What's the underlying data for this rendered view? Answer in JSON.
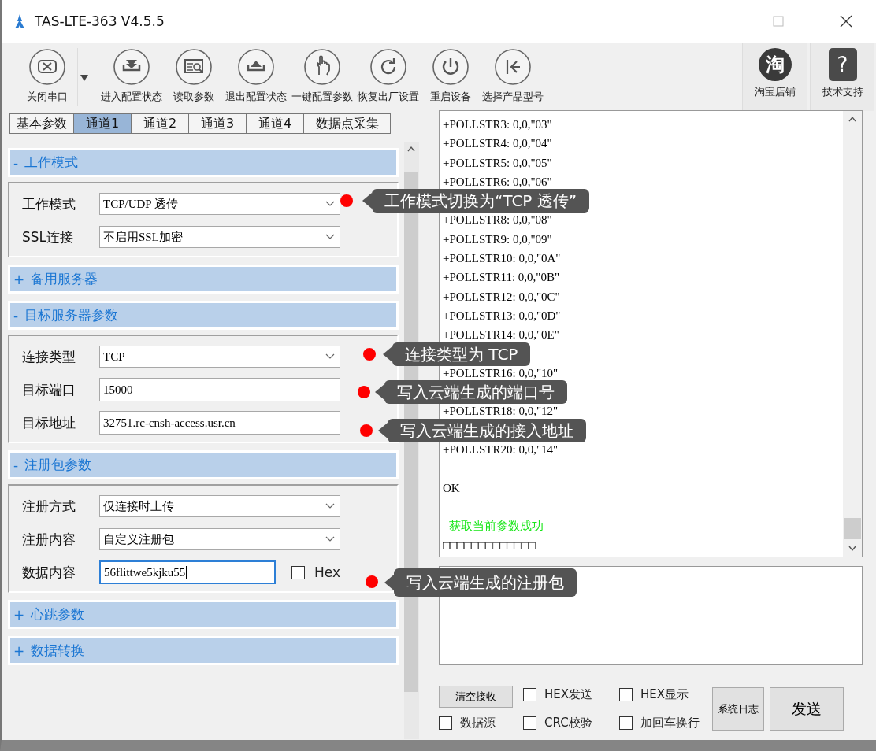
{
  "window": {
    "title": "TAS-LTE-363 V4.5.5"
  },
  "toolbar": [
    {
      "label": "关闭串口",
      "kind": "close",
      "has_menu": true
    },
    {
      "label": "进入配置状态",
      "kind": "enter",
      "has_menu": false
    },
    {
      "label": "读取参数",
      "kind": "read",
      "has_menu": false
    },
    {
      "label": "退出配置状态",
      "kind": "exit",
      "has_menu": false
    },
    {
      "label": "一键配置参数",
      "kind": "hand",
      "has_menu": false
    },
    {
      "label": "恢复出厂设置",
      "kind": "restore",
      "has_menu": false
    },
    {
      "label": "重启设备",
      "kind": "power",
      "has_menu": false
    },
    {
      "label": "选择产品型号",
      "kind": "back",
      "has_menu": false
    }
  ],
  "links": [
    {
      "label": "淘宝店铺",
      "kind": "shop",
      "icon_text": "淘"
    },
    {
      "label": "技术支持",
      "kind": "help",
      "icon_text": "?"
    }
  ],
  "tabs": [
    {
      "label": "基本参数",
      "selected": false
    },
    {
      "label": "通道1",
      "selected": true
    },
    {
      "label": "通道2",
      "selected": false
    },
    {
      "label": "通道3",
      "selected": false
    },
    {
      "label": "通道4",
      "selected": false
    },
    {
      "label": "数据点采集",
      "selected": false
    }
  ],
  "sections": [
    {
      "toggle": "-",
      "title": "工作模式",
      "expanded": true,
      "fields": [
        {
          "kind": "select",
          "label": "工作模式",
          "value": "TCP/UDP 透传"
        },
        {
          "kind": "select",
          "label": "SSL连接",
          "value": "不启用SSL加密"
        }
      ]
    },
    {
      "toggle": "+",
      "title": "备用服务器",
      "expanded": false
    },
    {
      "toggle": "-",
      "title": "目标服务器参数",
      "expanded": true,
      "fields": [
        {
          "kind": "select",
          "label": "连接类型",
          "value": "TCP"
        },
        {
          "kind": "input",
          "label": "目标端口",
          "value": "15000",
          "focused": false
        },
        {
          "kind": "input",
          "label": "目标地址",
          "value": "32751.rc-cnsh-access.usr.cn",
          "focused": false
        }
      ]
    },
    {
      "toggle": "-",
      "title": "注册包参数",
      "expanded": true,
      "fields": [
        {
          "kind": "select",
          "label": "注册方式",
          "value": "仅连接时上传"
        },
        {
          "kind": "select",
          "label": "注册内容",
          "value": "自定义注册包"
        },
        {
          "kind": "input",
          "label": "数据内容",
          "value": "56flittwe5kjku55",
          "focused": true,
          "checkbox": {
            "label": "Hex",
            "checked": false
          }
        }
      ]
    },
    {
      "toggle": "+",
      "title": "心跳参数",
      "expanded": false
    },
    {
      "toggle": "+",
      "title": "数据转换",
      "expanded": false
    }
  ],
  "log": [
    {
      "kind": "text",
      "text": "+POLLSTR3: 0,0,\"03\""
    },
    {
      "kind": "text",
      "text": "+POLLSTR4: 0,0,\"04\""
    },
    {
      "kind": "text",
      "text": "+POLLSTR5: 0,0,\"05\""
    },
    {
      "kind": "text",
      "text": "+POLLSTR6: 0,0,\"06\""
    },
    {
      "kind": "empty"
    },
    {
      "kind": "text",
      "text": "+POLLSTR8: 0,0,\"08\""
    },
    {
      "kind": "text",
      "text": "+POLLSTR9: 0,0,\"09\""
    },
    {
      "kind": "text",
      "text": "+POLLSTR10: 0,0,\"0A\""
    },
    {
      "kind": "text",
      "text": "+POLLSTR11: 0,0,\"0B\""
    },
    {
      "kind": "text",
      "text": "+POLLSTR12: 0,0,\"0C\""
    },
    {
      "kind": "text",
      "text": "+POLLSTR13: 0,0,\"0D\""
    },
    {
      "kind": "text",
      "text": "+POLLSTR14: 0,0,\"0E\""
    },
    {
      "kind": "empty"
    },
    {
      "kind": "text",
      "text": "+POLLSTR16: 0,0,\"10\""
    },
    {
      "kind": "empty"
    },
    {
      "kind": "text",
      "text": "+POLLSTR18: 0,0,\"12\""
    },
    {
      "kind": "empty"
    },
    {
      "kind": "text",
      "text": "+POLLSTR20: 0,0,\"14\""
    },
    {
      "kind": "empty"
    },
    {
      "kind": "text",
      "text": "OK"
    },
    {
      "kind": "empty"
    },
    {
      "kind": "status",
      "text": "获取当前参数成功"
    },
    {
      "kind": "text",
      "text": "□□□□□□□□□□□□□"
    }
  ],
  "bottom": {
    "clear_button": "清空接收",
    "checkboxes": [
      {
        "label": "HEX发送",
        "checked": false
      },
      {
        "label": "HEX显示",
        "checked": false
      },
      {
        "label": "数据源",
        "checked": false
      },
      {
        "label": "CRC校验",
        "checked": false
      },
      {
        "label": "加回车换行",
        "checked": false
      }
    ],
    "log_button": "系统日志",
    "send_button": "发送"
  },
  "callouts": [
    {
      "text": "工作模式切换为“TCP 透传”"
    },
    {
      "text": "连接类型为 TCP"
    },
    {
      "text": "写入云端生成的端口号"
    },
    {
      "text": "写入云端生成的接入地址"
    },
    {
      "text": "写入云端生成的注册包"
    }
  ]
}
